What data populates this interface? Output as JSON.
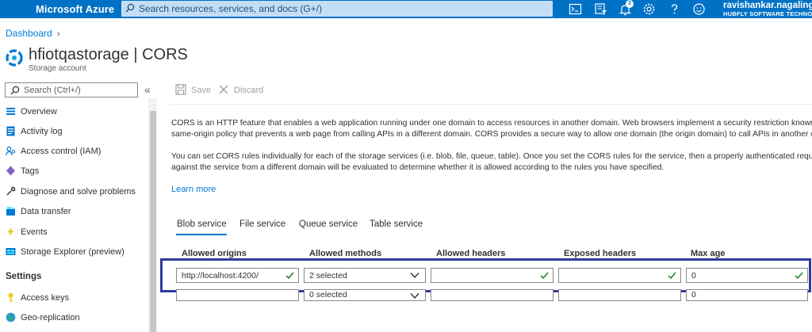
{
  "topbar": {
    "brand": "Microsoft Azure",
    "search_placeholder": "Search resources, services, and docs (G+/)",
    "notification_count": "3",
    "user_name": "ravishankar.nagalinga",
    "user_org": "HUBFLY SOFTWARE TECHNOLO",
    "icons": [
      "cloud-shell-icon",
      "directory-filter-icon",
      "bell-icon",
      "gear-icon",
      "help-icon",
      "feedback-icon"
    ]
  },
  "header": {
    "breadcrumb": "Dashboard",
    "title": "hfiotqastorage | CORS",
    "subtitle": "Storage account"
  },
  "sidebar": {
    "search_placeholder": "Search (Ctrl+/)",
    "collapse_label": "«",
    "items": [
      {
        "label": "Overview",
        "icon": "overview-icon"
      },
      {
        "label": "Activity log",
        "icon": "activity-log-icon"
      },
      {
        "label": "Access control (IAM)",
        "icon": "iam-icon"
      },
      {
        "label": "Tags",
        "icon": "tag-icon"
      },
      {
        "label": "Diagnose and solve problems",
        "icon": "wrench-icon"
      },
      {
        "label": "Data transfer",
        "icon": "data-transfer-icon"
      },
      {
        "label": "Events",
        "icon": "lightning-icon"
      },
      {
        "label": "Storage Explorer (preview)",
        "icon": "storage-explorer-icon"
      }
    ],
    "settings_heading": "Settings",
    "settings_items": [
      {
        "label": "Access keys",
        "icon": "key-icon"
      },
      {
        "label": "Geo-replication",
        "icon": "globe-icon"
      }
    ]
  },
  "toolbar": {
    "save_label": "Save",
    "discard_label": "Discard"
  },
  "content": {
    "para1_line1": "CORS is an HTTP feature that enables a web application running under one domain to access resources in another domain. Web browsers implement a security restriction known a",
    "para1_line2": "same-origin policy that prevents a web page from calling APIs in a different domain. CORS provides a secure way to allow one domain (the origin domain) to call APIs in another c",
    "para2_line1": "You can set CORS rules individually for each of the storage services (i.e. blob, file, queue, table). Once you set the CORS rules for the service, then a properly authenticated request",
    "para2_line2": "against the service from a different domain will be evaluated to determine whether it is allowed according to the rules you have specified.",
    "learn_more": "Learn more"
  },
  "tabs": [
    {
      "label": "Blob service",
      "active": true
    },
    {
      "label": "File service",
      "active": false
    },
    {
      "label": "Queue service",
      "active": false
    },
    {
      "label": "Table service",
      "active": false
    }
  ],
  "grid": {
    "columns": [
      "Allowed origins",
      "Allowed methods",
      "Allowed headers",
      "Exposed headers",
      "Max age"
    ],
    "rows": [
      {
        "origins": "http://localhost:4200/",
        "methods": "2 selected",
        "allowed_headers": "",
        "exposed_headers": "",
        "max_age": "0"
      },
      {
        "origins": "",
        "methods": "0 selected",
        "allowed_headers": "",
        "exposed_headers": "",
        "max_age": "0"
      }
    ]
  },
  "colors": {
    "topbar": "#0072c6",
    "accent": "#0078d4",
    "highlight_border": "#2e3c9f",
    "check": "#107c10"
  }
}
